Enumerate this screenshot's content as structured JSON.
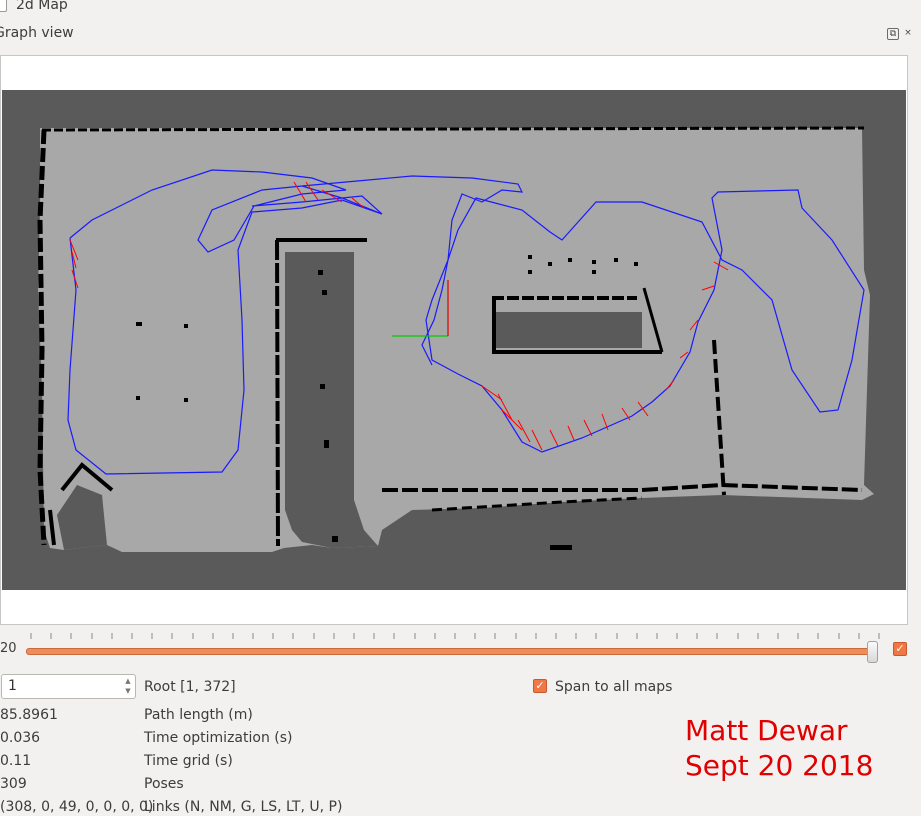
{
  "top_checkbox": {
    "label": "2d Map",
    "checked": false
  },
  "dock": {
    "title": "Graph view",
    "float_icon": "float-icon",
    "close_icon": "close-icon",
    "close_glyph": "×",
    "float_glyph": "⧉"
  },
  "slider": {
    "value_label": "20",
    "checkbox_checked": true,
    "fraction": 0.998
  },
  "controls": {
    "spin_value": "1",
    "root_label": "Root [1, 372]",
    "span_checkbox_label": "Span to all maps",
    "span_checked": true
  },
  "stats": [
    {
      "value": "85.8961",
      "label": "Path length (m)"
    },
    {
      "value": "0.036",
      "label": "Time optimization (s)"
    },
    {
      "value": "0.11",
      "label": "Time grid (s)"
    },
    {
      "value": "309",
      "label": "Poses"
    },
    {
      "value": "(308, 0, 49, 0, 0, 0, 0)",
      "label": "Links (N, NM, G, LS, LT, U, P)"
    }
  ],
  "signature": {
    "line1": "Matt Dewar",
    "line2": "Sept 20 2018"
  },
  "colors": {
    "accent": "#f07746",
    "map_unknown": "#5a5a5a",
    "map_free": "#a8a8a8",
    "map_wall": "#000000",
    "path": "#1a1aff",
    "loop_closure": "#ff0000",
    "signature": "#e00000"
  }
}
